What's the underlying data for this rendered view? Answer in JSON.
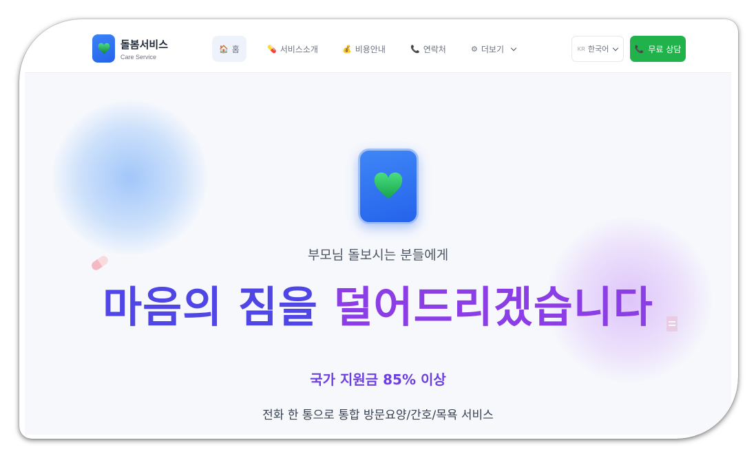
{
  "header": {
    "brand_title": "돌봄서비스",
    "brand_subtitle": "Care Service",
    "logo_icon": "heart-icon",
    "nav": [
      {
        "label": "홈",
        "icon": "🏠"
      },
      {
        "label": "서비스소개",
        "icon": "💊"
      },
      {
        "label": "비용안내",
        "icon": "💰"
      },
      {
        "label": "연락처",
        "icon": "📞"
      },
      {
        "label": "더보기",
        "icon": "⚙"
      }
    ],
    "language": {
      "flag": "KR",
      "label": "한국어"
    },
    "consult_button": {
      "icon": "📞",
      "label": "무료 상담"
    }
  },
  "hero": {
    "icon": "heart-icon",
    "pretitle": "부모님 돌보시는 분들에게",
    "title_part1": "마음의 짐을 ",
    "title_part2": "덜어드리겠습니다",
    "subtitle": "국가 지원금 85% 이상",
    "description": "전화 한 통으로 통합 방문요양/간호/목욕 서비스"
  },
  "colors": {
    "primary_blue": "#2563eb",
    "indigo": "#4f46e5",
    "purple": "#8b3ee6",
    "green": "#22b24c",
    "heart_green": "#22c55e"
  }
}
